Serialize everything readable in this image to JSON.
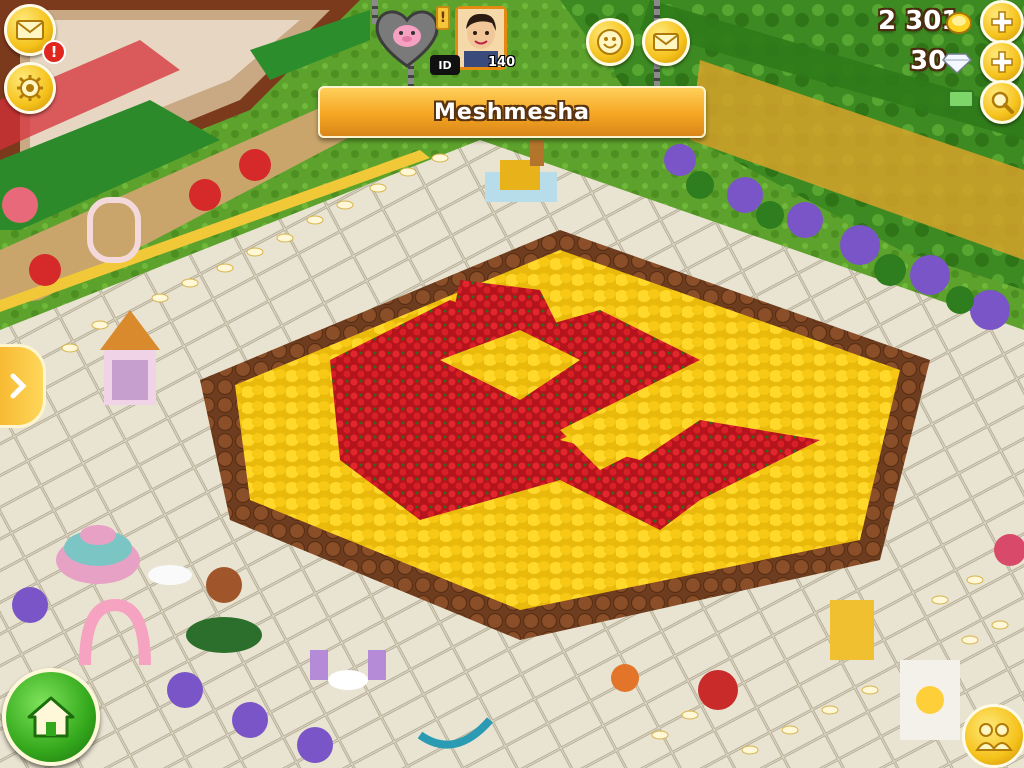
{
  "game": {
    "farm_name": "Meshmesha",
    "player_id_label": "ID",
    "player_level": "140"
  },
  "currency": {
    "coins": "2 301",
    "diamonds": "30"
  },
  "icons": {
    "mail": "envelope-icon",
    "settings": "gear-icon",
    "notification": "exclamation-badge",
    "friendship": "pig-heart-icon",
    "smiley": "smiley-icon",
    "messages": "envelope-icon",
    "add_coins": "plus-icon",
    "add_diamonds": "plus-icon",
    "search": "magnifier-icon",
    "expand": "chevron-right-icon",
    "home": "house-icon",
    "friends": "people-icon"
  },
  "colors": {
    "accent": "#f5c21b",
    "banner": "#f5a622",
    "home_button": "#34a81c",
    "badge": "#e0271f"
  }
}
